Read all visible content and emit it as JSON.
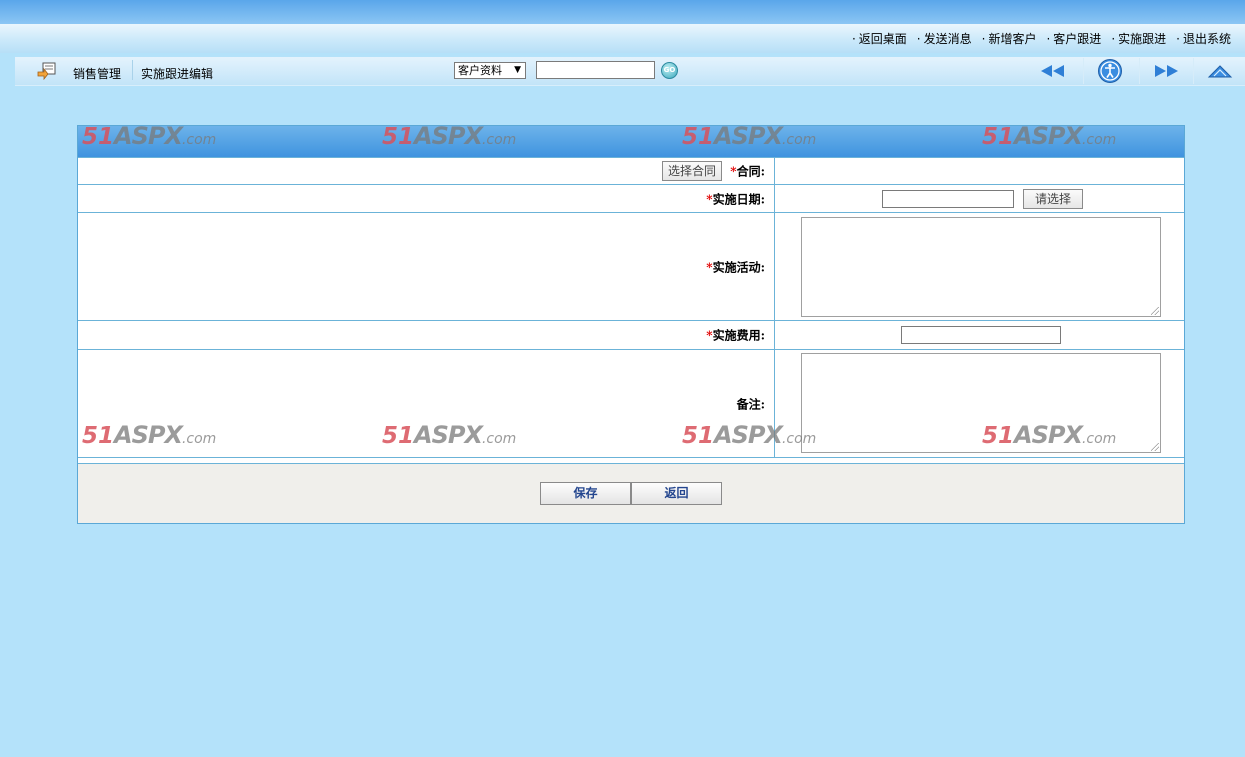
{
  "top_links": [
    "返回桌面",
    "发送消息",
    "新增客户",
    "客户跟进",
    "实施跟进",
    "退出系统"
  ],
  "toolbar": {
    "module_title": "销售管理",
    "page_title": "实施跟进编辑",
    "search_select": "客户资料",
    "search_value": "",
    "go_label": "GO"
  },
  "panel": {
    "header_title": ""
  },
  "form": {
    "required_mark": "*",
    "contract_label": "合同:",
    "select_contract_button": "选择合同",
    "date_label": "实施日期:",
    "date_value": "",
    "date_picker_button": "请选择",
    "activity_label": "实施活动:",
    "activity_value": "",
    "cost_label": "实施费用:",
    "cost_value": "",
    "remark_label": "备注:",
    "remark_value": ""
  },
  "actions": {
    "save": "保存",
    "back": "返回"
  },
  "watermark": {
    "num": "51",
    "word": "ASPX",
    "suffix": ".com"
  },
  "colors": {
    "page_background": "#b4e2fa",
    "panel_header": "#4a9be2",
    "row_border": "#6bb3d8",
    "required": "#e00000",
    "action_text": "#24468f"
  }
}
